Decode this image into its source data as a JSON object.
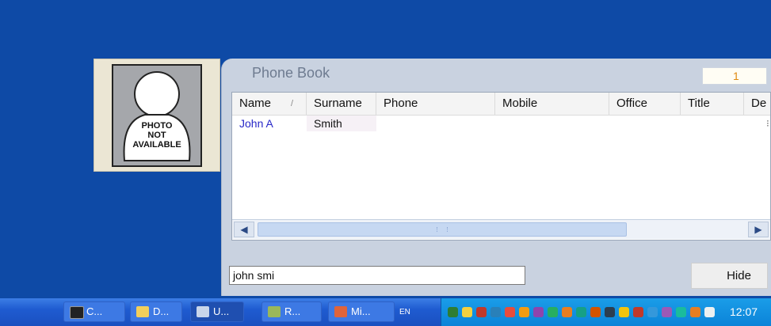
{
  "photo": {
    "placeholder_lines": [
      "PHOTO",
      "NOT",
      "AVAILABLE"
    ]
  },
  "phonebook": {
    "title": "Phone Book",
    "counter": "1",
    "columns": [
      "Name",
      "Surname",
      "Phone",
      "Mobile",
      "Office",
      "Title",
      "De"
    ],
    "rows": [
      {
        "name": "John A",
        "surname": "Smith",
        "phone": "",
        "mobile": "",
        "office": "",
        "title": ""
      }
    ],
    "search": {
      "value": "john smi"
    },
    "hide_label": "Hide"
  },
  "taskbar": {
    "tasks": [
      {
        "label": "C...",
        "icon": "console-icon"
      },
      {
        "label": "D...",
        "icon": "folder-icon"
      },
      {
        "label": "U...",
        "icon": "app-window-icon"
      },
      {
        "label": "R...",
        "icon": "tool-icon"
      },
      {
        "label": "Mi...",
        "icon": "mail-icon"
      }
    ],
    "language": "EN",
    "clock": "12:07"
  },
  "colors": {
    "desktop": "#0e4aa6",
    "window": "#c9d2e0",
    "accent": "#e08a10",
    "name_link": "#2828c8"
  }
}
